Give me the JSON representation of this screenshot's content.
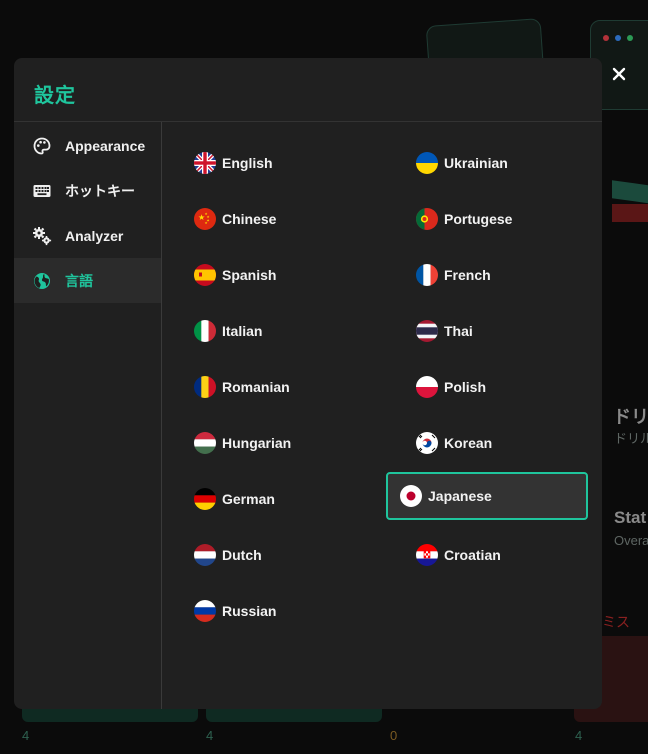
{
  "background": {
    "title_fragment": "ドリ",
    "subtitle_fragment": "ドリル",
    "stat_fragment": "Stat",
    "stat_sub_fragment": "Overa",
    "miss_fragment": "ミス",
    "bottom_numbers": [
      "4",
      "4",
      "0",
      "4"
    ]
  },
  "modal": {
    "title": "設定",
    "close_label": "×"
  },
  "sidebar": {
    "items": [
      {
        "label": "Appearance",
        "icon": "palette-icon"
      },
      {
        "label": "ホットキー",
        "icon": "keyboard-icon"
      },
      {
        "label": "Analyzer",
        "icon": "gears-icon"
      },
      {
        "label": "言語",
        "icon": "globe-icon",
        "active": true
      }
    ]
  },
  "languages": {
    "left": [
      "English",
      "Chinese",
      "Spanish",
      "Italian",
      "Romanian",
      "Hungarian",
      "German",
      "Dutch",
      "Russian"
    ],
    "right": [
      "Ukrainian",
      "Portugese",
      "French",
      "Thai",
      "Polish",
      "Korean",
      "Japanese",
      "Croatian"
    ],
    "selected": "Japanese"
  },
  "colors": {
    "accent": "#1fc59d",
    "modal_bg": "#202020",
    "backdrop": "#0b0b0b"
  }
}
